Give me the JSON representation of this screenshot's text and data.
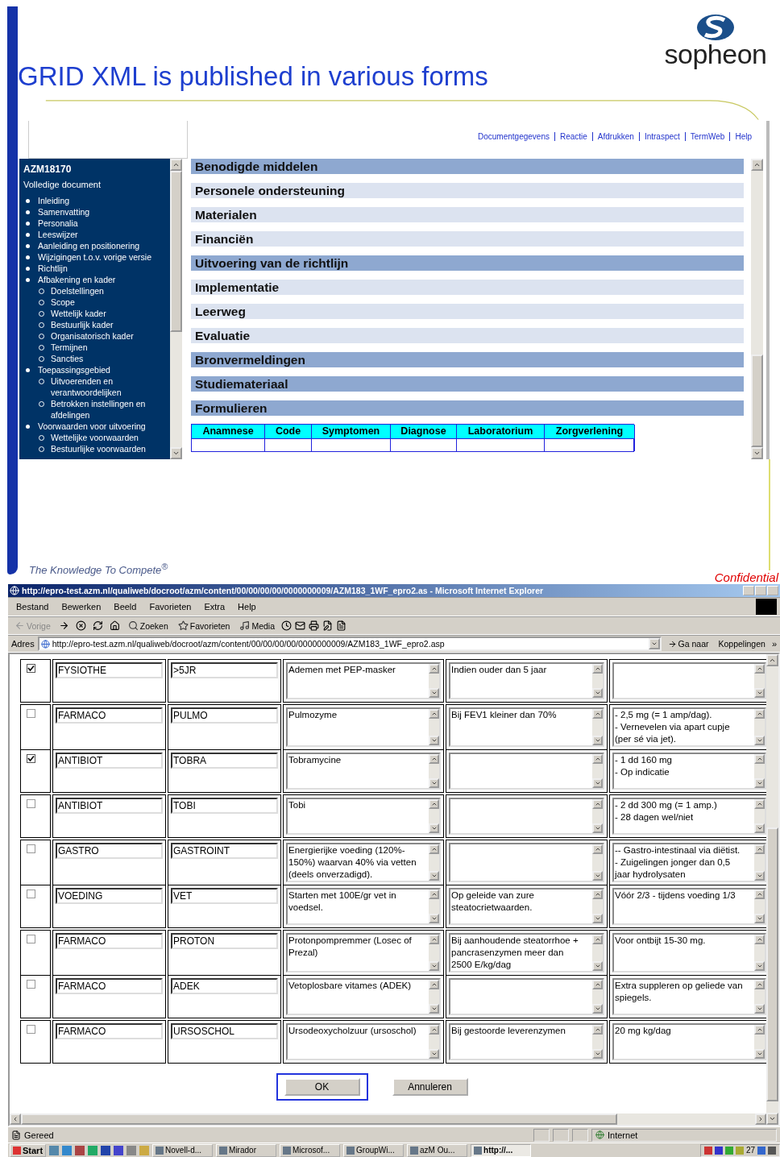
{
  "slide": {
    "title": "GRID XML is published in various forms",
    "logo": "sopheon",
    "tagline": "The Knowledge To Compete$^{®}$",
    "classification": "Confidential"
  },
  "web_page": {
    "links": [
      "Documentgegevens",
      "Reactie",
      "Afdrukken",
      "Intraspect",
      "TermWeb",
      "Help"
    ],
    "nav": {
      "doc_id": "AZM18170",
      "heading": "Volledige document",
      "items": [
        {
          "label": "Inleiding"
        },
        {
          "label": "Samenvatting"
        },
        {
          "label": "Personalia"
        },
        {
          "label": "Leeswijzer"
        },
        {
          "label": "Aanleiding en positionering"
        },
        {
          "label": "Wijzigingen t.o.v. vorige versie"
        },
        {
          "label": "Richtlijn"
        },
        {
          "label": "Afbakening en kader",
          "children": [
            {
              "label": "Doelstellingen"
            },
            {
              "label": "Scope"
            },
            {
              "label": "Wettelijk kader"
            },
            {
              "label": "Bestuurlijk kader"
            },
            {
              "label": "Organisatorisch kader"
            },
            {
              "label": "Termijnen"
            },
            {
              "label": "Sancties"
            }
          ]
        },
        {
          "label": "Toepassingsgebied",
          "children": [
            {
              "label": "Uitvoerenden en verantwoordelijken"
            },
            {
              "label": "Betrokken instellingen en afdelingen"
            }
          ]
        },
        {
          "label": "Voorwaarden voor uitvoering",
          "children": [
            {
              "label": "Wettelijke voorwaarden"
            },
            {
              "label": "Bestuurlijke voorwaarden"
            }
          ]
        }
      ]
    },
    "sections": [
      {
        "title": "Benodigde middelen",
        "kind": "main"
      },
      {
        "title": "Personele ondersteuning",
        "kind": "sub"
      },
      {
        "title": "Materialen",
        "kind": "sub"
      },
      {
        "title": "Financiën",
        "kind": "sub"
      },
      {
        "title": "Uitvoering van de richtlijn",
        "kind": "main"
      },
      {
        "title": "Implementatie",
        "kind": "sub"
      },
      {
        "title": "Leerweg",
        "kind": "sub"
      },
      {
        "title": "Evaluatie",
        "kind": "sub"
      },
      {
        "title": "Bronvermeldingen",
        "kind": "main"
      },
      {
        "title": "Studiemateriaal",
        "kind": "main"
      },
      {
        "title": "Formulieren",
        "kind": "main"
      }
    ],
    "table": {
      "columns": [
        "Anamnese",
        "Code",
        "Symptomen",
        "Diagnose",
        "Laboratorium",
        "Zorgverlening"
      ]
    }
  },
  "browser": {
    "title": "http://epro-test.azm.nl/qualiweb/docroot/azm/content/00/00/00/00/0000000009/AZM183_1WF_epro2.as - Microsoft Internet Explorer",
    "menu": [
      "Bestand",
      "Bewerken",
      "Beeld",
      "Favorieten",
      "Extra",
      "Help"
    ],
    "toolbar": [
      {
        "label": "Vorige",
        "disabled": true
      },
      {
        "label": "Zoeken",
        "disabled": false
      },
      {
        "label": "Favorieten",
        "disabled": false
      },
      {
        "label": "Media",
        "disabled": false
      }
    ],
    "address_label": "Adres",
    "url": "http://epro-test.azm.nl/qualiweb/docroot/azm/content/00/00/00/00/0000000009/AZM183_1WF_epro2.asp",
    "go": "Ga naar",
    "links_label": "Koppelingen",
    "more": "»",
    "rows": [
      {
        "checked": true,
        "category": "FYSIOTHE",
        "code": ">5JR",
        "treatment": "Ademen met PEP-masker",
        "condition": "Indien ouder dan 5 jaar",
        "dosage": ""
      },
      {
        "checked": false,
        "category": "FARMACO",
        "code": "PULMO",
        "treatment": "Pulmozyme",
        "condition": "Bij FEV1 kleiner dan 70%",
        "dosage": "- 2,5 mg (= 1 amp/dag).\n- Vernevelen via apart cupje\n(per sé via jet)."
      },
      {
        "checked": true,
        "category": "ANTIBIOT",
        "code": "TOBRA",
        "treatment": "Tobramycine",
        "condition": "",
        "dosage": "- 1 dd 160 mg\n- Op indicatie"
      },
      {
        "checked": false,
        "category": "ANTIBIOT",
        "code": "TOBI",
        "treatment": "Tobi",
        "condition": "",
        "dosage": "- 2 dd 300 mg (= 1 amp.)\n- 28 dagen wel/niet"
      },
      {
        "checked": false,
        "category": "GASTRO",
        "code": "GASTROINT",
        "treatment": "Energierijke voeding (120%-\n150%) waarvan 40% via vetten\n(deels onverzadigd).",
        "condition": "",
        "dosage": "-- Gastro-intestinaal via diëtist.\n- Zuigelingen jonger dan 0,5\njaar hydrolysaten"
      },
      {
        "checked": false,
        "category": "VOEDING",
        "code": "VET",
        "treatment": "Starten met 100E/gr vet in\nvoedsel.",
        "condition": "Op geleide van zure\nsteatocrietwaarden.",
        "dosage": "Vóór 2/3 - tijdens voeding 1/3"
      },
      {
        "checked": false,
        "category": "FARMACO",
        "code": "PROTON",
        "treatment": "Protonpompremmer (Losec of\nPrezal)",
        "condition": "Bij aanhoudende steatorrhoe +\npancrasenzymen meer dan\n2500 E/kg/dag",
        "dosage": "Voor ontbijt 15-30 mg."
      },
      {
        "checked": false,
        "category": "FARMACO",
        "code": "ADEK",
        "treatment": "Vetoplosbare vitames (ADEK)",
        "condition": "",
        "dosage": "Extra suppleren op geliede van\nspiegels."
      },
      {
        "checked": false,
        "category": "FARMACO",
        "code": "URSOSCHOL",
        "treatment": "Ursodeoxycholzuur (ursoschol)",
        "condition": "Bij gestoorde leverenzymen",
        "dosage": "20 mg kg/dag"
      }
    ],
    "buttons": [
      {
        "label": "OK",
        "focused": true
      },
      {
        "label": "Annuleren",
        "focused": false
      }
    ],
    "status": "Gereed",
    "zone": "Internet"
  },
  "taskbar": {
    "start": "Start",
    "tasks": [
      {
        "label": "Novell-d...",
        "selected": false
      },
      {
        "label": "Mirador",
        "selected": false
      },
      {
        "label": "Microsof...",
        "selected": false
      },
      {
        "label": "GroupWi...",
        "selected": false
      },
      {
        "label": "azM Ou...",
        "selected": false
      },
      {
        "label": "http://...",
        "selected": true
      }
    ],
    "tray_date": "27"
  }
}
